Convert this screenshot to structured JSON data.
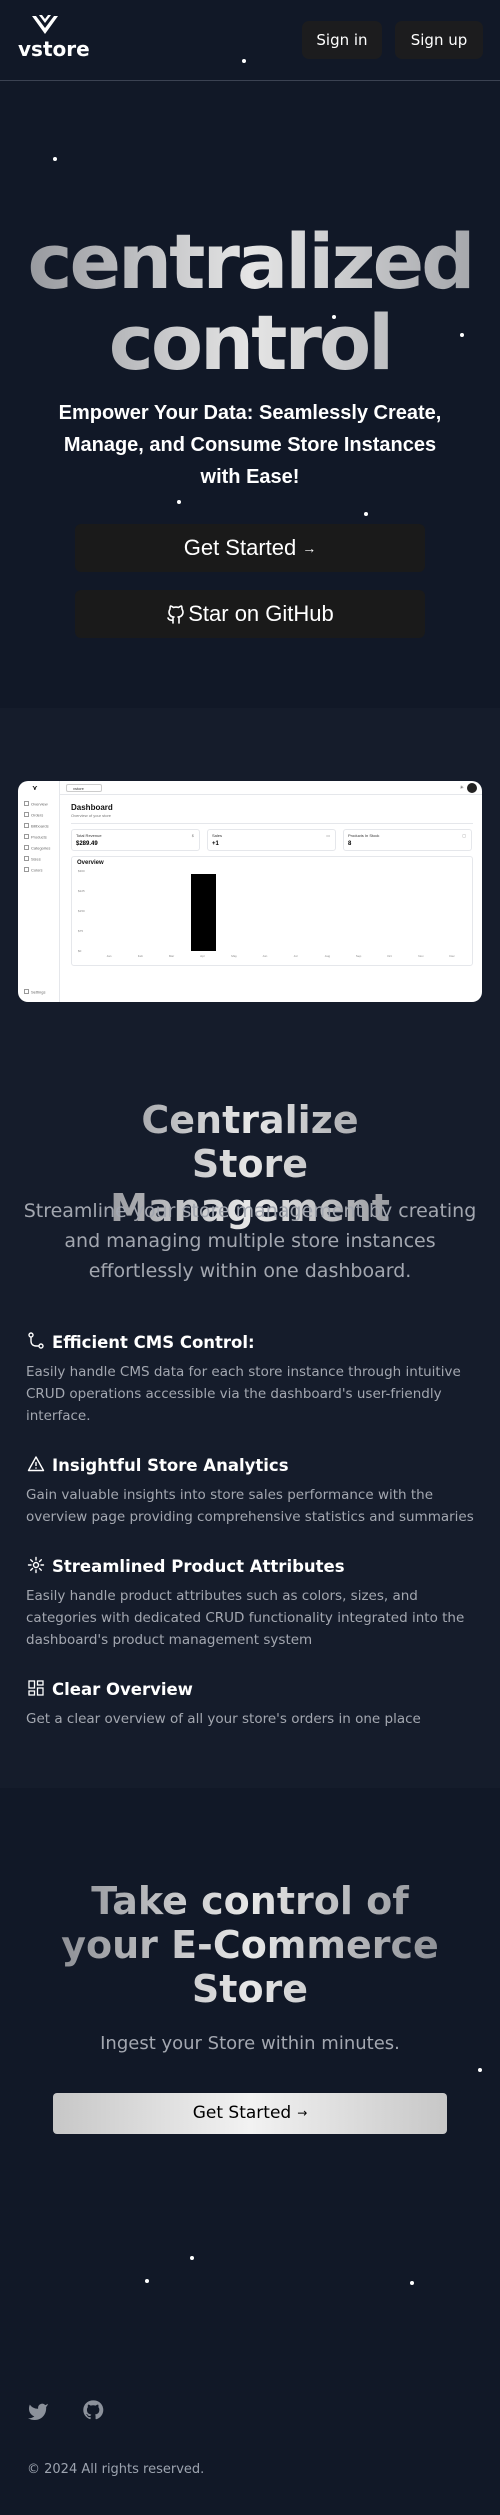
{
  "header": {
    "logo_text": "vstore",
    "signin_label": "Sign in",
    "signup_label": "Sign up"
  },
  "hero": {
    "title_line1": "centralized",
    "title_line2": "control",
    "subtitle": "Empower Your Data: Seamlessly Create, Manage, and Consume Store Instances with Ease!",
    "get_started_label": "Get Started",
    "github_label": "Star on GitHub"
  },
  "dashboard_preview": {
    "store_switcher": "vstore",
    "title": "Dashboard",
    "subtitle": "Overview of your store",
    "sidebar": [
      "Overview",
      "Orders",
      "Billboards",
      "Products",
      "Categories",
      "Sizes",
      "Colors"
    ],
    "settings_label": "Settings",
    "cards": [
      {
        "label": "Total Revenue",
        "value": "$289.49",
        "icon": "$"
      },
      {
        "label": "Sales",
        "value": "+1",
        "icon": "▭"
      },
      {
        "label": "Products In Stock",
        "value": "8",
        "icon": "▢"
      }
    ],
    "overview_title": "Overview",
    "y_ticks": [
      "$300",
      "$225",
      "$150",
      "$75",
      "$0"
    ],
    "months": [
      "Jan",
      "Feb",
      "Mar",
      "Apr",
      "May",
      "Jun",
      "Jul",
      "Aug",
      "Sep",
      "Oct",
      "Nov",
      "Dec"
    ],
    "chart_values": [
      0,
      0,
      0,
      289.49,
      0,
      0,
      0,
      0,
      0,
      0,
      0,
      0
    ]
  },
  "features": {
    "heading": "Centralize Store Management",
    "lead": "Streamline your store management by creating and managing multiple store instances effortlessly within one dashboard.",
    "items": [
      {
        "icon": "git-branch-icon",
        "title": "Efficient CMS Control:",
        "desc": "Easily handle CMS data for each store instance through intuitive CRUD operations accessible via the dashboard's user-friendly interface."
      },
      {
        "icon": "warning-triangle-icon",
        "title": "Insightful Store Analytics",
        "desc": "Gain valuable insights into store sales performance with the overview page providing comprehensive statistics and summaries"
      },
      {
        "icon": "settings-gear-icon",
        "title": "Streamlined Product Attributes",
        "desc": "Easily handle product attributes such as colors, sizes, and categories with dedicated CRUD functionality integrated into the dashboard's product management system"
      },
      {
        "icon": "dashboard-grid-icon",
        "title": "Clear Overview",
        "desc": "Get a clear overview of all your store's orders in one place"
      }
    ]
  },
  "cta": {
    "heading": "Take control of your E-Commerce Store",
    "sub": "Ingest your Store within minutes.",
    "button_label": "Get Started"
  },
  "footer": {
    "copyright": "© 2024 All rights reserved.",
    "icons": [
      "twitter-icon",
      "github-icon"
    ]
  }
}
